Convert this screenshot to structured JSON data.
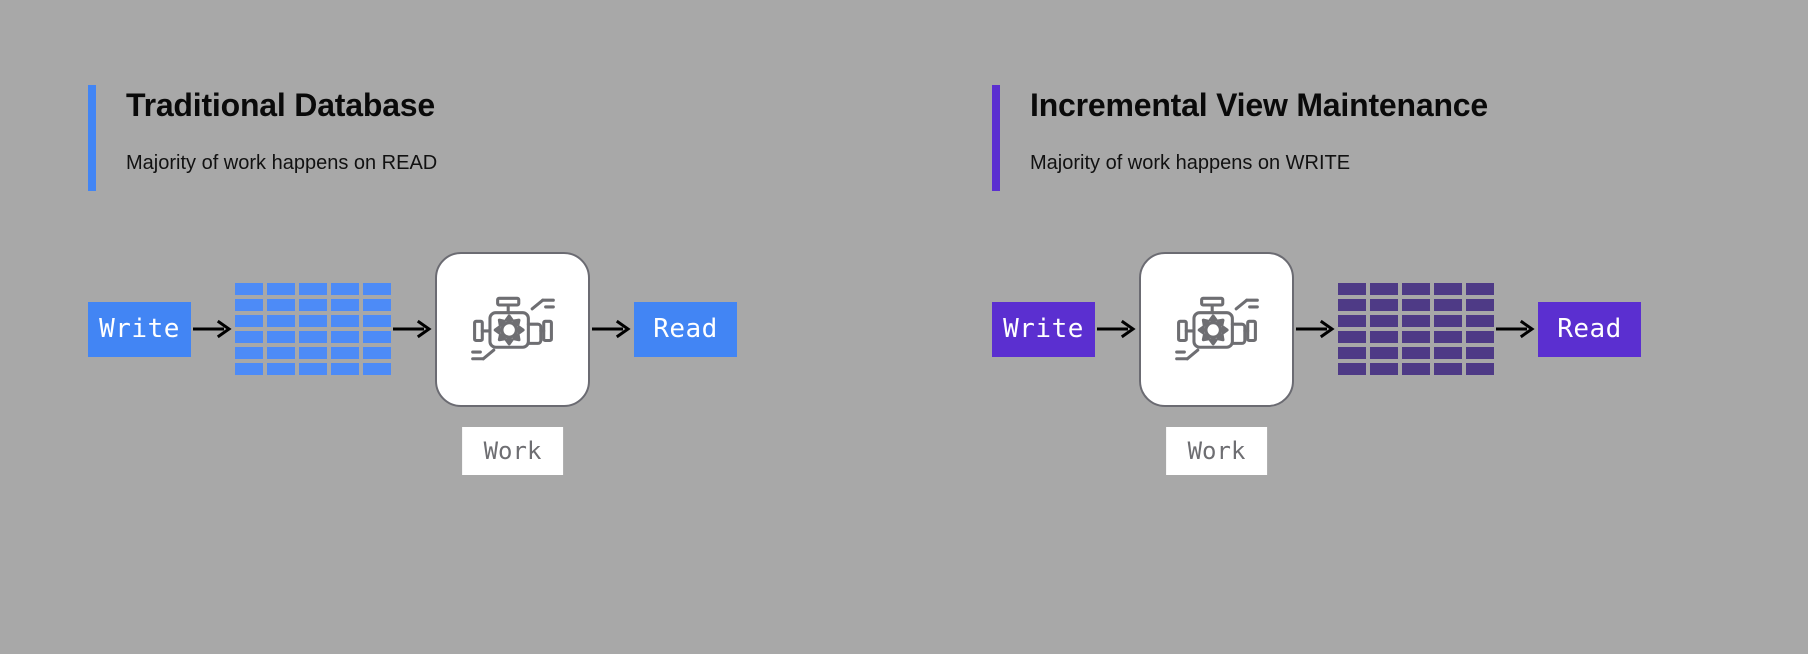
{
  "background_color": "#a8a8a8",
  "panels": [
    {
      "id": "traditional-database",
      "accent_color": "#4285f4",
      "title": "Traditional Database",
      "subtitle": "Majority of work happens on READ",
      "box_color": "#4285f4",
      "grid_color": "#4d8bf7",
      "grid_columns": 5,
      "grid_rows": 6,
      "write_label": "Write",
      "read_label": "Read",
      "work_label": "Work",
      "arrow_glyph": "arrow-right",
      "order": [
        "write",
        "grid",
        "engine",
        "read"
      ]
    },
    {
      "id": "incremental-view-maintenance",
      "accent_color": "#5b2fd0",
      "title": "Incremental View Maintenance",
      "subtitle": "Majority of work happens on WRITE",
      "box_color": "#5b2fd0",
      "grid_color": "#4e3a86",
      "grid_columns": 5,
      "grid_rows": 6,
      "write_label": "Write",
      "read_label": "Read",
      "work_label": "Work",
      "arrow_glyph": "arrow-right",
      "order": [
        "write",
        "engine",
        "grid",
        "read"
      ]
    }
  ],
  "icons": {
    "engine": "engine-icon",
    "arrow": "arrow-right-icon"
  }
}
